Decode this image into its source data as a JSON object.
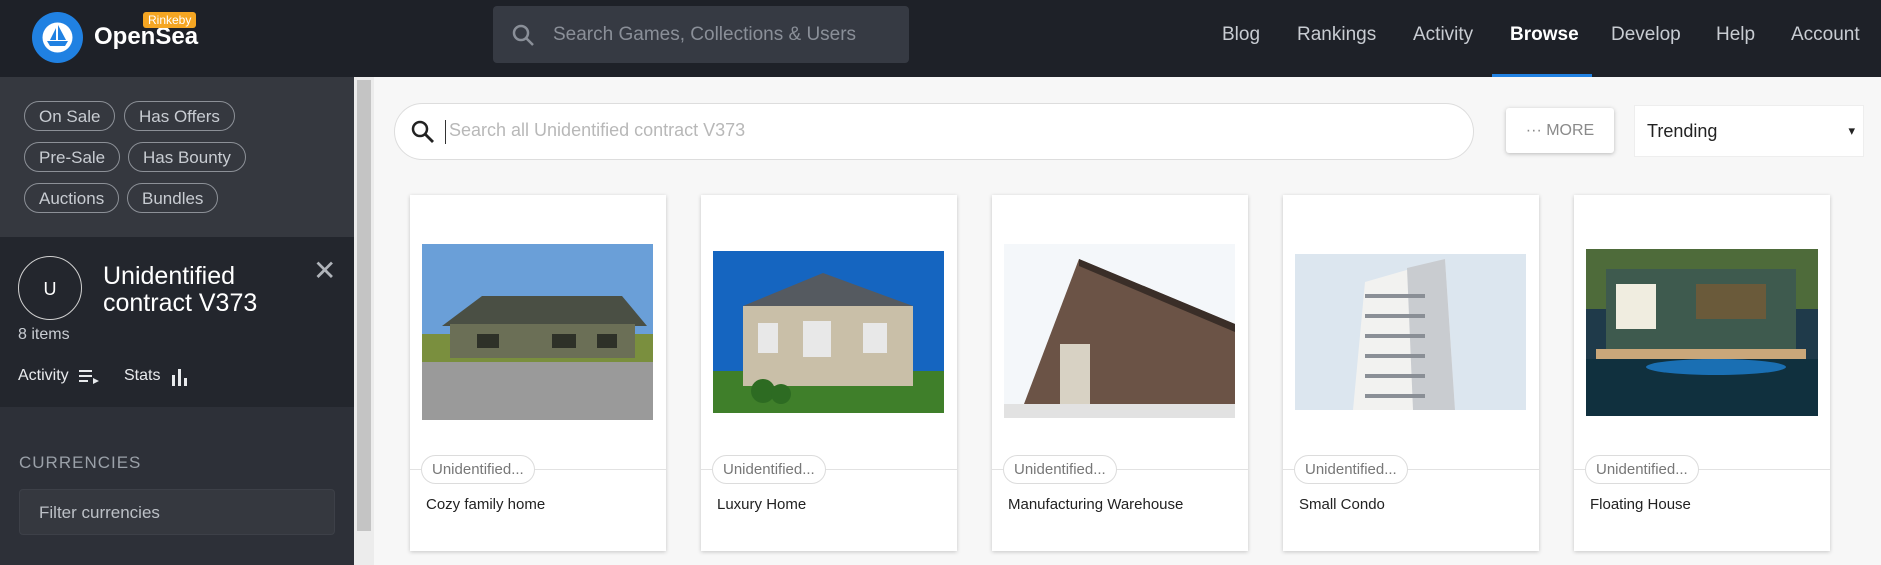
{
  "header": {
    "brand": "OpenSea",
    "badge": "Rinkeby",
    "search_placeholder": "Search Games, Collections & Users",
    "nav": [
      "Blog",
      "Rankings",
      "Activity",
      "Browse",
      "Develop",
      "Help",
      "Account"
    ],
    "active_nav": "Browse"
  },
  "sidebar": {
    "filters": [
      "On Sale",
      "Has Offers",
      "Pre-Sale",
      "Has Bounty",
      "Auctions",
      "Bundles"
    ],
    "collection": {
      "avatar_letter": "U",
      "title": "Unidentified contract V373",
      "items_count": "8 items",
      "activity_label": "Activity",
      "stats_label": "Stats",
      "close_glyph": "✕"
    },
    "currencies_heading": "CURRENCIES",
    "currency_filter_placeholder": "Filter currencies"
  },
  "main": {
    "search_placeholder": "Search all Unidentified contract V373",
    "more_label": "··· MORE",
    "sort_value": "Trending",
    "sort_caret": "▾"
  },
  "cards": [
    {
      "collection": "Unidentified...",
      "name": "Cozy family home"
    },
    {
      "collection": "Unidentified...",
      "name": "Luxury Home"
    },
    {
      "collection": "Unidentified...",
      "name": "Manufacturing Warehouse"
    },
    {
      "collection": "Unidentified...",
      "name": "Small Condo"
    },
    {
      "collection": "Unidentified...",
      "name": "Floating House"
    }
  ],
  "colors": {
    "nav_bg": "#1e2128",
    "accent": "#2081e2",
    "badge": "#f5a623",
    "sidebar_bg": "#2d3038"
  }
}
